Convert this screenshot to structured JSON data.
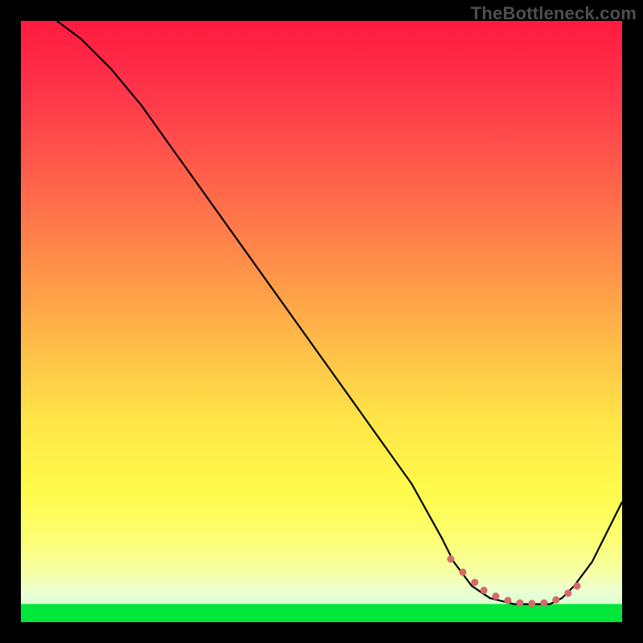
{
  "watermark": {
    "text": "TheBottleneck.com"
  },
  "colors": {
    "curve": "#000000",
    "marker": "#d66a6a",
    "green": "#00e63a"
  },
  "chart_data": {
    "type": "line",
    "title": "",
    "xlabel": "",
    "ylabel": "",
    "xlim": [
      0,
      100
    ],
    "ylim": [
      0,
      100
    ],
    "grid": false,
    "series": [
      {
        "name": "curve",
        "x": [
          6,
          10,
          15,
          20,
          25,
          30,
          35,
          40,
          45,
          50,
          55,
          60,
          65,
          70,
          72,
          75,
          78,
          80,
          82,
          85,
          88,
          90,
          92,
          95,
          100
        ],
        "values": [
          100,
          97,
          92,
          86,
          79,
          72,
          65,
          58,
          51,
          44,
          37,
          30,
          23,
          14,
          10,
          6,
          4,
          3.5,
          3,
          3,
          3,
          4,
          6,
          10,
          20
        ]
      }
    ],
    "markers": {
      "x": [
        71.5,
        73.5,
        75.5,
        77,
        79,
        81,
        83,
        85,
        87,
        89,
        91,
        92.5
      ],
      "values": [
        10.5,
        8.3,
        6.6,
        5.3,
        4.3,
        3.6,
        3.2,
        3.1,
        3.2,
        3.7,
        4.8,
        6.0
      ],
      "color": "#d66a6a",
      "size": 9
    }
  }
}
